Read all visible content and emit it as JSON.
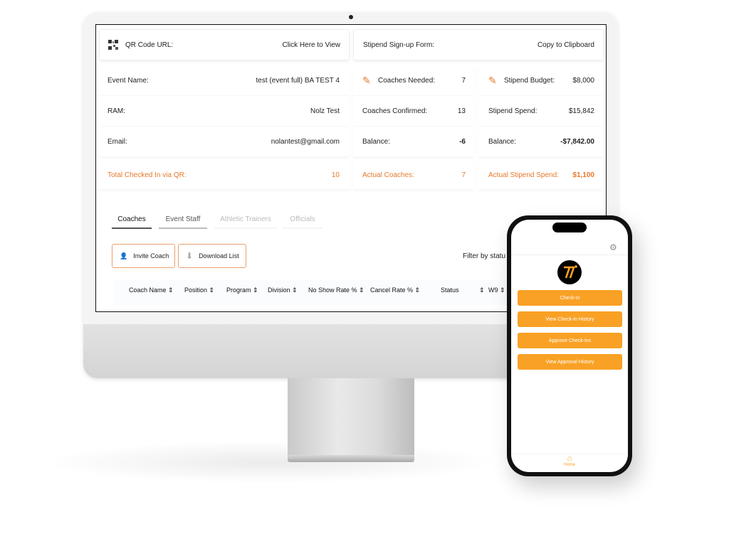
{
  "accent": "#f9a125",
  "info_cards": {
    "qr_label": "QR Code URL:",
    "qr_link": "Click Here to View",
    "stipend_label": "Stipend Sign-up Form:",
    "stipend_link": "Copy to Clipboard"
  },
  "details": {
    "event_name_label": "Event Name:",
    "event_name": "test (event full) BA TEST 4",
    "ram_label": "RAM:",
    "ram": "Nolz Test",
    "email_label": "Email:",
    "email": "nolantest@gmail.com",
    "checked_in_label": "Total Checked In via QR:",
    "checked_in": "10",
    "coaches_needed_label": "Coaches Needed:",
    "coaches_needed": "7",
    "coaches_confirmed_label": "Coaches Confirmed:",
    "coaches_confirmed": "13",
    "coach_balance_label": "Balance:",
    "coach_balance": "-6",
    "actual_coaches_label": "Actual Coaches:",
    "actual_coaches": "7",
    "stipend_budget_label": "Stipend Budget:",
    "stipend_budget": "$8,000",
    "stipend_spend_label": "Stipend Spend:",
    "stipend_spend": "$15,842",
    "stipend_balance_label": "Balance:",
    "stipend_balance": "-$7,842.00",
    "actual_stipend_label": "Actual Stipend Spend:",
    "actual_stipend": "$1,100"
  },
  "tabs": [
    "Coaches",
    "Event Staff",
    "Athletic Trainers",
    "Officials"
  ],
  "actions": {
    "invite": "Invite Coach",
    "download": "Download List",
    "filter": "Filter by statu"
  },
  "table_headers": [
    "Coach Name",
    "Position",
    "Program",
    "Division",
    "No Show Rate %",
    "Cancel Rate %",
    "Status",
    "W9"
  ],
  "phone": {
    "buttons": [
      "Check-in",
      "View Check-in History",
      "Approve Check-ins",
      "View Approval History"
    ],
    "nav_home": "Home"
  }
}
